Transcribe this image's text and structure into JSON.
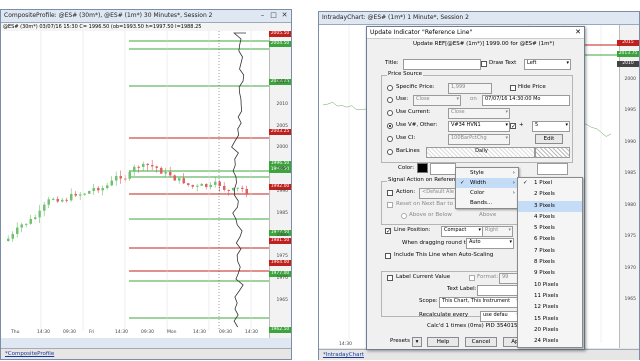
{
  "left_window": {
    "title": "CompositeProfile: @ES# (30m*), @ES# (1m*) 30 Minutes*, Session 2",
    "info": "@ES# (30m*) 03/07/16 15:30 C= 1996.50 (ob=1993.50 h=1997.50 l=1988.25",
    "price_labels": [
      {
        "text": "2005.50",
        "color": "#c0201e"
      },
      {
        "text": "2004.50",
        "color": "#3ca43c"
      },
      {
        "text": "2013.75",
        "color": "#3ca43c"
      },
      {
        "text": "2003.25",
        "color": "#c0201e"
      },
      {
        "text": "1996.50",
        "color": "#3ca43c"
      },
      {
        "text": "1993.50",
        "color": "#3ca43c"
      },
      {
        "text": "1992.00",
        "color": "#c0201e"
      },
      {
        "text": "1977.50",
        "color": "#3ca43c"
      },
      {
        "text": "1981.50",
        "color": "#c0201e"
      },
      {
        "text": "1964.00",
        "color": "#c0201e"
      },
      {
        "text": "1977.00",
        "color": "#3ca43c"
      },
      {
        "text": "1962.50",
        "color": "#3ca43c"
      }
    ],
    "price_ticks": [
      "2015",
      "2010",
      "2005",
      "2000",
      "1995",
      "1990",
      "1985",
      "1980",
      "1975",
      "1970",
      "1965"
    ],
    "time_labels": [
      "Thu\n03/03",
      "14:30",
      "09:30",
      "Fri\n03/04",
      "14:30",
      "09:30",
      "Mon\n03/07",
      "14:30",
      "09:30",
      "14:30"
    ],
    "tab": "*CompositeProfile"
  },
  "right_window": {
    "title": "IntradayChart: @ES# (1m*) 1 Minute*, Session 2",
    "price_labels": [
      {
        "text": "2015",
        "color": "#c0201e"
      },
      {
        "text": "2013.75",
        "color": "#3ca43c"
      },
      {
        "text": "2010",
        "color": "#444"
      }
    ],
    "price_ticks": [
      "2000",
      "1995",
      "1990",
      "1985",
      "1980",
      "1975",
      "1970",
      "1965"
    ],
    "time_labels": [
      "14:30",
      "09:30",
      "14:30"
    ],
    "tab": "*IntradayChart"
  },
  "dialog": {
    "title": "Update Indicator \"Reference Line\"",
    "close": "✕",
    "heading": "Update REF[@ES# (1m*)] 1999.00 for @ES# (1m*)",
    "title_label": "Title:",
    "title_value": "",
    "draw_text_label": "Draw Text",
    "draw_text_position": "Left",
    "price_source_label": "Price Source",
    "specific_price_label": "Specific Price:",
    "specific_price_value": "1,999",
    "hide_price_label": "Hide Price",
    "use_label": "Use:",
    "use_value": "Close",
    "on_label": "on",
    "date_value": "07/07/16 14:30:00 Mo",
    "use_current_label": "Use Current:",
    "use_current_value": "Close",
    "use_var_label": "Use V#, Other:",
    "use_var_value": "V#34 HVN1",
    "plus_label": "+",
    "offset_value": "5",
    "use_ci_label": "Use CI:",
    "use_ci_value": "100BarPctChg",
    "edit_label": "Edit",
    "barlines_label": "BarLines",
    "barlines_value": "Daily",
    "color_label": "Color:",
    "signal_action_label": "Signal Action on Reference",
    "action_label": "Action:",
    "action_value": "<Default Ale",
    "reset_label": "Reset on Next Bar to Re",
    "above_below_label": "Above or Below",
    "above_label": "Above",
    "line_position_label": "Line Position:",
    "line_position_value": "Compact",
    "right_value": "Right",
    "dragging_label": "When dragging round to:",
    "dragging_value": "Auto",
    "include_autoscale_label": "Include This Line when Auto-Scaling",
    "label_current_value_label": "Label Current Value",
    "format_label": "Format:",
    "format_value": "99",
    "text_label": "Text Label:",
    "scope_label": "Scope:",
    "scope_value": "This Chart, This Instrument",
    "recalc_label": "Recalculate every",
    "recalc_value": "use defau",
    "calc_info": "Calc'd 1 times (0ms) PID 35401599",
    "presets_label": "Presets",
    "help_label": "Help",
    "cancel_label": "Cancel",
    "apply_label": "Apply",
    "ok_label": "OK"
  },
  "context_menu": {
    "items": [
      {
        "label": "Style",
        "arrow": "›",
        "selected": false
      },
      {
        "label": "Width",
        "arrow": "›",
        "selected": true
      },
      {
        "label": "Color",
        "arrow": "›",
        "selected": false
      },
      {
        "label": "Bands...",
        "arrow": "",
        "selected": false
      }
    ],
    "check": "✓"
  },
  "width_submenu": {
    "items": [
      "1 Pixel",
      "2 Pixels",
      "3 Pixels",
      "4 Pixels",
      "5 Pixels",
      "6 Pixels",
      "7 Pixels",
      "8 Pixels",
      "9 Pixels",
      "10 Pixels",
      "11 Pixels",
      "12 Pixels",
      "15 Pixels",
      "20 Pixels",
      "24 Pixels"
    ],
    "checked_index": 0,
    "highlighted_index": 2
  },
  "colors": {
    "up_candle": "#6fc36f",
    "down_candle": "#e06060",
    "red_line": "#c0201e",
    "green_line": "#3ca43c",
    "titlebar": "#dfe7f2"
  }
}
